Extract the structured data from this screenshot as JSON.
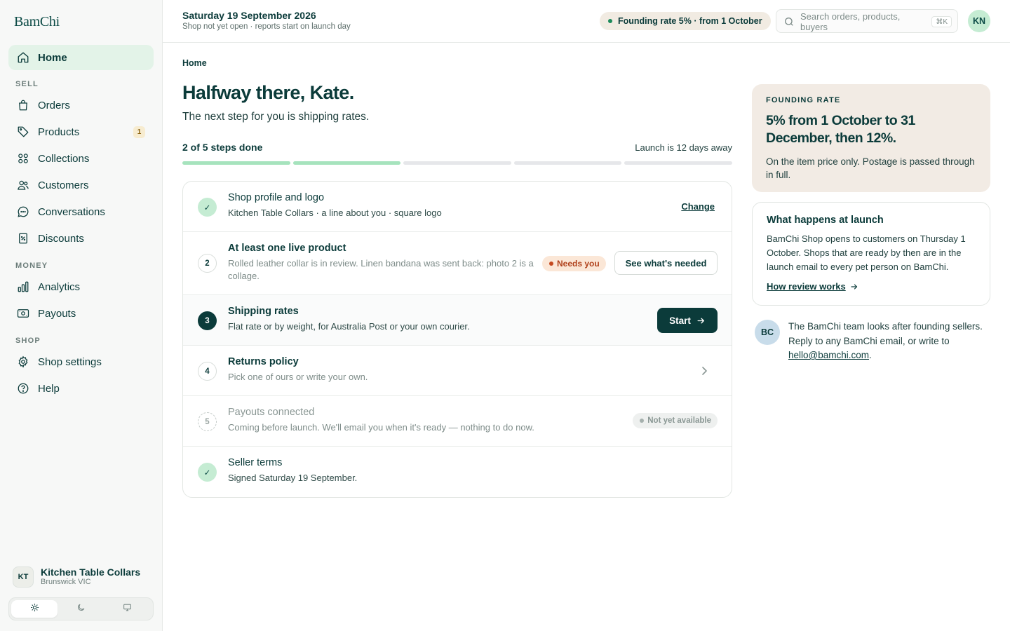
{
  "brand": "BamChi",
  "sidebar": {
    "home": "Home",
    "sections": {
      "sell": "SELL",
      "money": "MONEY",
      "shop": "SHOP"
    },
    "items": {
      "orders": "Orders",
      "products": "Products",
      "products_count": "1",
      "collections": "Collections",
      "customers": "Customers",
      "conversations": "Conversations",
      "discounts": "Discounts",
      "analytics": "Analytics",
      "payouts": "Payouts",
      "shop_settings": "Shop settings",
      "help": "Help"
    },
    "shop": {
      "initials": "KT",
      "name": "Kitchen Table Collars",
      "location": "Brunswick VIC"
    },
    "theme": {
      "selected": "light"
    }
  },
  "topbar": {
    "date": "Saturday 19 September 2026",
    "date_sub": "Shop not yet open · reports start on launch day",
    "rate_pill": "Founding rate 5% · from 1 October",
    "search_placeholder": "Search orders, products, buyers",
    "search_shortcut": "⌘K",
    "user_initials": "KN"
  },
  "main": {
    "breadcrumb": "Home",
    "heading": "Halfway there, Kate.",
    "subheading": "The next step for you is shipping rates.",
    "steps_done": "2 of 5 steps done",
    "launch": "Launch is 12 days away",
    "progress": {
      "done": 2,
      "total": 5
    },
    "steps": [
      {
        "marker": "✓",
        "title": "Shop profile and logo",
        "desc": "Kitchen Table Collars · a line about you · square logo",
        "action": "Change"
      },
      {
        "marker": "2",
        "title": "At least one live product",
        "desc": "Rolled leather collar is in review. Linen bandana was sent back: photo 2 is a collage.",
        "badge": "Needs you",
        "action": "See what's needed"
      },
      {
        "marker": "3",
        "title": "Shipping rates",
        "desc": "Flat rate or by weight, for Australia Post or your own courier.",
        "action": "Start"
      },
      {
        "marker": "4",
        "title": "Returns policy",
        "desc": "Pick one of ours or write your own."
      },
      {
        "marker": "5",
        "title": "Payouts connected",
        "desc": "Coming before launch. We'll email you when it's ready — nothing to do now.",
        "badge": "Not yet available"
      },
      {
        "marker": "✓",
        "title": "Seller terms",
        "desc": "Signed Saturday 19 September."
      }
    ]
  },
  "aside": {
    "rate": {
      "kicker": "FOUNDING RATE",
      "title": "5% from 1 October to 31 December, then 12%.",
      "body": "On the item price only. Postage is passed through in full."
    },
    "launch": {
      "title": "What happens at launch",
      "body": "BamChi Shop opens to customers on Thursday 1 October. Shops that are ready by then are in the launch email to every pet person on BamChi.",
      "link": "How review works"
    },
    "team": {
      "initials": "BC",
      "text": "The BamChi team looks after founding sellers. Reply to any BamChi email, or write to",
      "email": "hello@bamchi.com",
      "end": "."
    }
  },
  "colors": {
    "accent": "#0b3b3a",
    "success": "#a6e3bd",
    "warning": "#c4481e",
    "rate_card": "#f2ebe4"
  }
}
